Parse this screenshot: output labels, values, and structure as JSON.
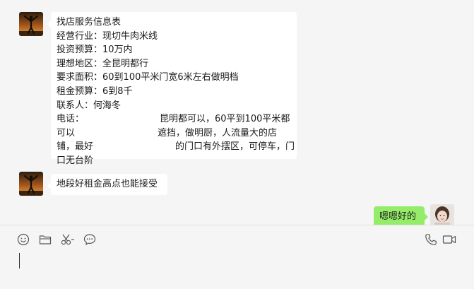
{
  "messages": {
    "form": {
      "lines": [
        "找店服务信息表",
        "经营行业：现切牛肉米线",
        "投资预算：10万内",
        "理想地区：全昆明都行",
        "要求面积：60到100平米门宽6米左右做明档",
        "租金预算：6到8千",
        "联系人：何海冬",
        "电话：",
        "昆明都可以，60平到100平米都",
        "可以",
        "遮挡，做明厨，人流量大的店",
        "铺，最好",
        "的门口有外摆区，可停车，门",
        "口无台阶"
      ]
    },
    "followup": "地段好租金高点也能接受",
    "reply": "嗯嗯好的"
  },
  "toolbar": {
    "icons": [
      "emoji-icon",
      "folder-icon",
      "scissors-icon",
      "chat-history-icon",
      "phone-icon",
      "video-icon"
    ]
  },
  "colors": {
    "background": "#f5f5f5",
    "bubble_left": "#ffffff",
    "bubble_right": "#95ec69"
  }
}
